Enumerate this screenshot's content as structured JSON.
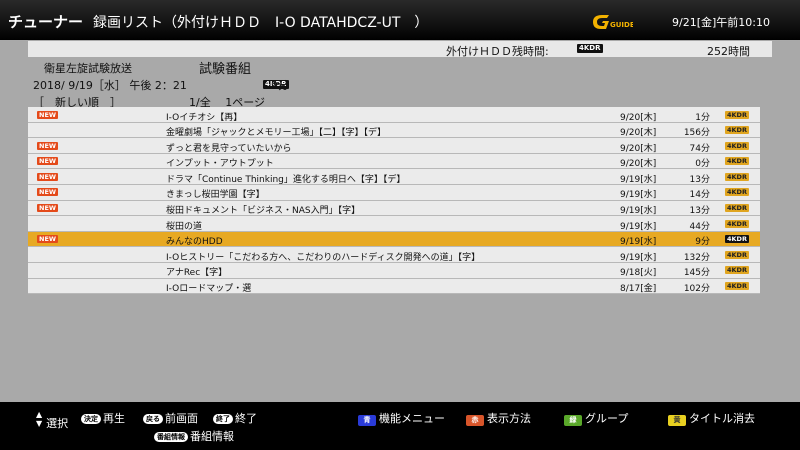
{
  "header": {
    "tuner": "チューナー",
    "title": "録画リスト（外付けＨＤＤ　I-O DATAHDCZ-UT　）",
    "logo_text": "G GUIDE",
    "clock": "9/21[金]午前10:10"
  },
  "remain": {
    "label": "外付けＨＤＤ残時間:",
    "badge": "4KDR",
    "value": "252時間"
  },
  "info": {
    "channel": "衛星左旋試験放送",
    "program_title": "試験番組",
    "datetime": "2018/ 9/19［水］ 午後 2：21",
    "duration": "9分",
    "badge": "4KDR",
    "sort_order": "［　新しい順　］",
    "pager": "1/全　 1ページ"
  },
  "list": {
    "rows": [
      {
        "new": "NEW",
        "title": "I-Oイチオシ【再】",
        "date": "9/20[木]",
        "duration": "1分",
        "badge": "4KDR"
      },
      {
        "new": "",
        "title": "金曜劇場「ジャックとメモリー工場」【二】【字】【デ】",
        "date": "9/20[木]",
        "duration": "156分",
        "badge": "4KDR"
      },
      {
        "new": "NEW",
        "title": "ずっと君を見守っていたいから",
        "date": "9/20[木]",
        "duration": "74分",
        "badge": "4KDR"
      },
      {
        "new": "NEW",
        "title": "インプット・アウトプット",
        "date": "9/20[木]",
        "duration": "0分",
        "badge": "4KDR"
      },
      {
        "new": "NEW",
        "title": "ドラマ「Continue Thinking」進化する明日へ【字】【デ】",
        "date": "9/19[水]",
        "duration": "13分",
        "badge": "4KDR"
      },
      {
        "new": "NEW",
        "title": "きまっし桜田学園【字】",
        "date": "9/19[水]",
        "duration": "14分",
        "badge": "4KDR"
      },
      {
        "new": "NEW",
        "title": "桜田ドキュメント「ビジネス・NAS入門」【字】",
        "date": "9/19[水]",
        "duration": "13分",
        "badge": "4KDR"
      },
      {
        "new": "",
        "title": "桜田の道",
        "date": "9/19[水]",
        "duration": "44分",
        "badge": "4KDR"
      },
      {
        "new": "NEW",
        "title": "みんなのHDD",
        "date": "9/19[水]",
        "duration": "9分",
        "badge": "4KDR",
        "selected": true
      },
      {
        "new": "",
        "title": "I-Oヒストリー「こだわる方へ、こだわりのハードディスク開発への道」【字】",
        "date": "9/19[水]",
        "duration": "132分",
        "badge": "4KDR"
      },
      {
        "new": "",
        "title": "アナRec【字】",
        "date": "9/18[火]",
        "duration": "145分",
        "badge": "4KDR"
      },
      {
        "new": "",
        "title": "I-Oロードマップ・選",
        "date": "8/17[金]",
        "duration": "102分",
        "badge": "4KDR"
      }
    ]
  },
  "footer": {
    "select_label": "選択",
    "enter_key": "決定",
    "play_label": "再生",
    "back_key": "戻る",
    "prev_label": "前画面",
    "exit_key": "終了",
    "exit_label": "終了",
    "info_key": "番組情報",
    "info_label": "番組情報",
    "blue_key": "青",
    "blue_label": "機能メニュー",
    "red_key": "赤",
    "red_label": "表示方法",
    "green_key": "緑",
    "green_label": "グループ",
    "yellow_key": "黄",
    "yellow_label": "タイトル消去"
  },
  "colors": {
    "selected_row": "#e7a923",
    "new_badge": "#e44a1a",
    "blue_key": "#2a3bd8",
    "red_key": "#d8552a",
    "green_key": "#5aa82a",
    "yellow_key": "#e8d020"
  }
}
